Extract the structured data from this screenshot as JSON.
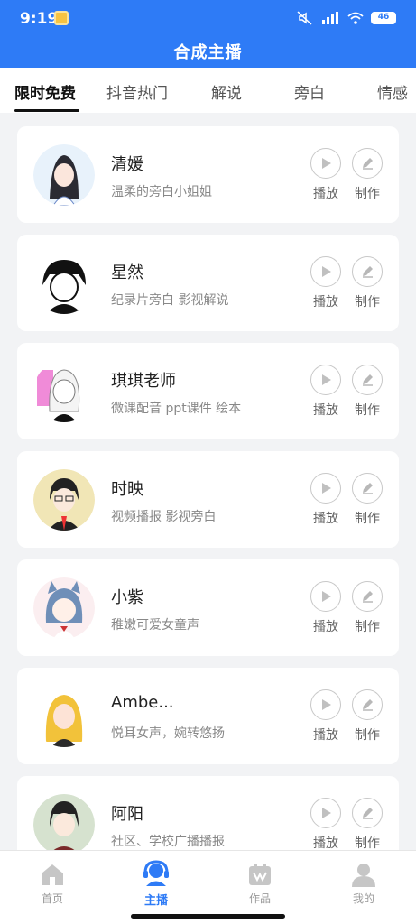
{
  "status": {
    "time": "9:19",
    "battery": "46"
  },
  "header": {
    "title": "合成主播"
  },
  "tabs": [
    {
      "label": "限时免费",
      "active": true
    },
    {
      "label": "抖音热门"
    },
    {
      "label": "解说"
    },
    {
      "label": "旁白"
    },
    {
      "label": "情感"
    }
  ],
  "actions": {
    "play_label": "播放",
    "make_label": "制作"
  },
  "anchors": [
    {
      "name": "清媛",
      "desc": "温柔的旁白小姐姐"
    },
    {
      "name": "星然",
      "desc": "纪录片旁白  影视解说"
    },
    {
      "name": "琪琪老师",
      "desc": "微课配音 ppt课件 绘本"
    },
    {
      "name": "时映",
      "desc": "视频播报  影视旁白"
    },
    {
      "name": "小紫",
      "desc": "稚嫩可爱女童声"
    },
    {
      "name": "Ambe...",
      "desc": "悦耳女声，婉转悠扬"
    },
    {
      "name": "阿阳",
      "desc": "社区、学校广播播报"
    }
  ],
  "bottom_nav": [
    {
      "label": "首页",
      "icon": "home-icon"
    },
    {
      "label": "主播",
      "icon": "anchor-icon",
      "active": true
    },
    {
      "label": "作品",
      "icon": "works-icon"
    },
    {
      "label": "我的",
      "icon": "profile-icon"
    }
  ],
  "colors": {
    "accent": "#2e7bf6",
    "background": "#f2f3f5"
  }
}
